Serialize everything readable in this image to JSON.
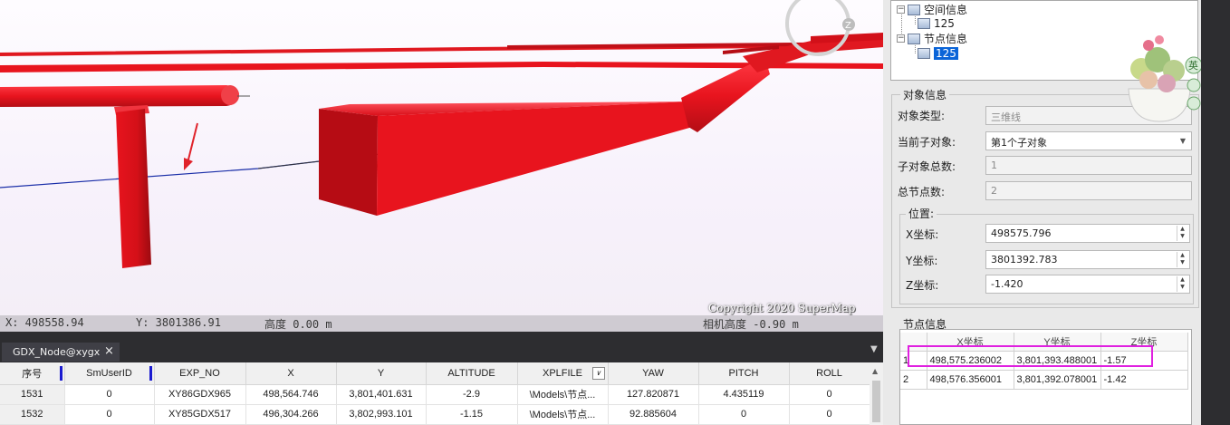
{
  "viewport": {
    "status": {
      "x": "X: 498558.94",
      "y": "Y: 3801386.91",
      "height": "高度 0.00 m",
      "camera_height": "相机高度 -0.90 m"
    },
    "copyright": "Copyright 2020 SuperMap",
    "compass_letter": "Z",
    "colors": {
      "pipe": "#e8141e",
      "pipe_dark": "#9c0a10",
      "sky": "#fefcff",
      "line_blue": "#1a2ea8"
    }
  },
  "table": {
    "tab_label": "GDX_Node@xygx",
    "tab_close": "×",
    "columns": [
      "序号",
      "SmUserID",
      "EXP_NO",
      "X",
      "Y",
      "ALTITUDE",
      "XPLFILE",
      "YAW",
      "PITCH",
      "ROLL"
    ],
    "rows": [
      [
        "1531",
        "0",
        "XY86GDX965",
        "498,564.746",
        "3,801,401.631",
        "-2.9",
        "\\Models\\节点...",
        "127.820871",
        "4.435119",
        "0"
      ],
      [
        "1532",
        "0",
        "XY85GDX517",
        "496,304.266",
        "3,802,993.101",
        "-1.15",
        "\\Models\\节点...",
        "92.885604",
        "0",
        "0"
      ]
    ]
  },
  "tree": {
    "spatial_info": "空间信息",
    "spatial_child": "125",
    "node_info": "节点信息",
    "node_child": "125"
  },
  "object_info": {
    "group_title": "对象信息",
    "object_type_label": "对象类型:",
    "object_type_value": "三维线",
    "current_sub_label": "当前子对象:",
    "current_sub_value": "第1个子对象",
    "sub_count_label": "子对象总数:",
    "sub_count_value": "1",
    "node_count_label": "总节点数:",
    "node_count_value": "2",
    "position_title": "位置:",
    "x_label": "X坐标:",
    "x_value": "498575.796",
    "y_label": "Y坐标:",
    "y_value": "3801392.783",
    "z_label": "Z坐标:",
    "z_value": "-1.420"
  },
  "node_info": {
    "group_title": "节点信息",
    "columns": [
      "",
      "X坐标",
      "Y坐标",
      "Z坐标"
    ],
    "rows": [
      [
        "1",
        "498,575.236002",
        "3,801,393.488001",
        "-1.57"
      ],
      [
        "2",
        "498,576.356001",
        "3,801,392.078001",
        "-1.42"
      ]
    ],
    "highlight_color": "#e020e0"
  },
  "widget": {
    "lang_label": "英"
  }
}
